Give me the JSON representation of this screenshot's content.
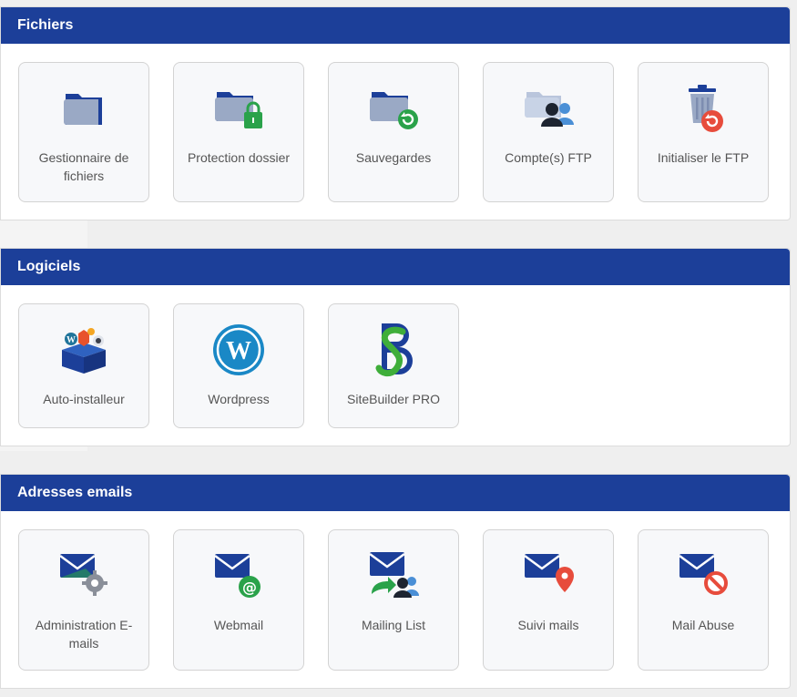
{
  "sections": [
    {
      "title": "Fichiers",
      "tiles": [
        {
          "label": "Gestionnaire de fichiers",
          "icon": "folder-icon"
        },
        {
          "label": "Protection dossier",
          "icon": "folder-lock-icon"
        },
        {
          "label": "Sauvegardes",
          "icon": "folder-backup-icon"
        },
        {
          "label": "Compte(s) FTP",
          "icon": "folder-users-icon"
        },
        {
          "label": "Initialiser le FTP",
          "icon": "trash-reset-icon"
        }
      ]
    },
    {
      "title": "Logiciels",
      "tiles": [
        {
          "label": "Auto-installeur",
          "icon": "installer-box-icon"
        },
        {
          "label": "Wordpress",
          "icon": "wordpress-icon"
        },
        {
          "label": "SiteBuilder PRO",
          "icon": "sitebuilder-icon"
        }
      ]
    },
    {
      "title": "Adresses emails",
      "tiles": [
        {
          "label": "Administration E-mails",
          "icon": "mail-settings-icon"
        },
        {
          "label": "Webmail",
          "icon": "mail-at-icon"
        },
        {
          "label": "Mailing List",
          "icon": "mail-forward-users-icon"
        },
        {
          "label": "Suivi mails",
          "icon": "mail-location-icon"
        },
        {
          "label": "Mail Abuse",
          "icon": "mail-blocked-icon"
        }
      ]
    }
  ],
  "colors": {
    "header": "#1c3f99",
    "folder": "#9aa9c5",
    "folder_tab": "#1c3f99",
    "green": "#2aa24a",
    "red": "#e74c3c"
  }
}
